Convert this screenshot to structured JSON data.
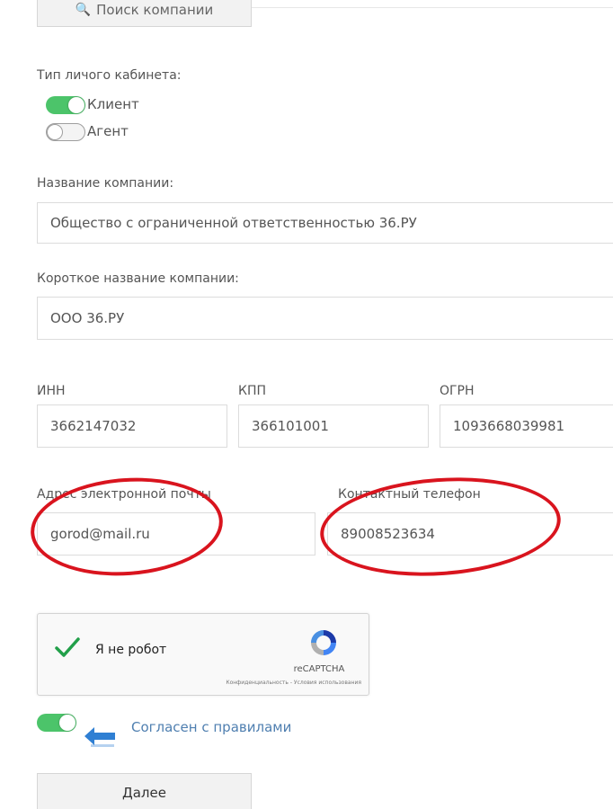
{
  "top": {
    "search_button_label": "Поиск компании"
  },
  "cabinet_type": {
    "label": "Тип личого кабинета:",
    "options": [
      {
        "label": "Клиент",
        "on": true
      },
      {
        "label": "Агент",
        "on": false
      }
    ]
  },
  "company_name": {
    "label": "Название компании:",
    "value": "Общество с ограниченной ответственностью 36.РУ"
  },
  "short_name": {
    "label": "Короткое название компании:",
    "value": "ООО 36.РУ"
  },
  "inn": {
    "label": "ИНН",
    "value": "3662147032"
  },
  "kpp": {
    "label": "КПП",
    "value": "366101001"
  },
  "ogrn": {
    "label": "ОГРН",
    "value": "1093668039981"
  },
  "email": {
    "label": "Адрес электронной почты",
    "value": "gorod@mail.ru"
  },
  "phone": {
    "label": "Контактный телефон",
    "value": "89008523634"
  },
  "captcha": {
    "label": "Я не робот",
    "brand": "reCAPTCHA",
    "links": "Конфиденциальность - Условия использования"
  },
  "agreement": {
    "label": "Согласен с правилами",
    "on": true
  },
  "next_button_label": "Далее",
  "colors": {
    "toggle_on": "#4cc46a",
    "annotation": "#d9141e",
    "arrow": "#2f7fd3",
    "link": "#4f7fb0"
  }
}
